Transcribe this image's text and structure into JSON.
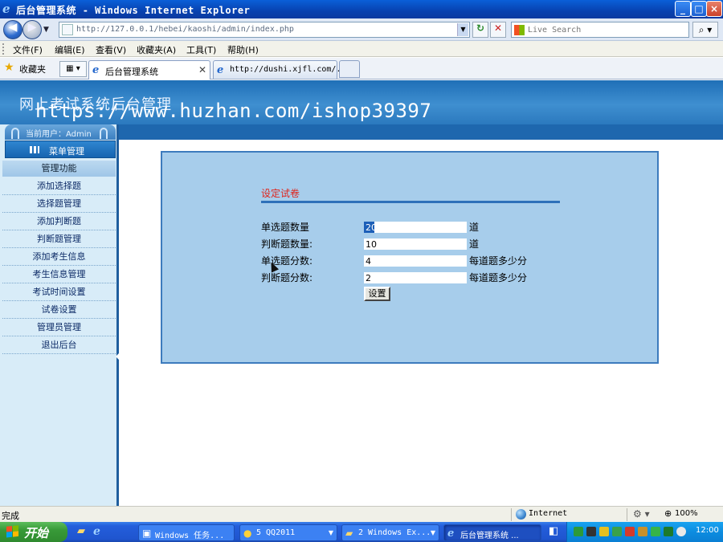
{
  "window": {
    "title": "后台管理系统 - Windows Internet Explorer",
    "controls": {
      "minimize": "_",
      "maximize": "□",
      "close": "×"
    }
  },
  "address_bar": {
    "url": "http://127.0.0.1/hebei/kaoshi/admin/index.php",
    "search_placeholder": "Live Search"
  },
  "menu": {
    "items": [
      "文件(F)",
      "编辑(E)",
      "查看(V)",
      "收藏夹(A)",
      "工具(T)",
      "帮助(H)"
    ]
  },
  "tabs": {
    "favorites_label": "收藏夹",
    "items": [
      {
        "label": "后台管理系统",
        "active": true
      },
      {
        "label": "http://dushi.xjfl.com/...",
        "active": false
      }
    ]
  },
  "site": {
    "title": "网上考试系统后台管理",
    "watermark": "https://www.huzhan.com/ishop39397"
  },
  "sidebar": {
    "user_label": "当前用户：Admin",
    "menu_header": "菜单管理",
    "section": "管理功能",
    "items": [
      {
        "label": "添加选择题"
      },
      {
        "label": "选择题管理"
      },
      {
        "label": "添加判断题"
      },
      {
        "label": "判断题管理"
      },
      {
        "label": "添加考生信息"
      },
      {
        "label": "考生信息管理"
      },
      {
        "label": "考试时间设置"
      },
      {
        "label": "试卷设置"
      },
      {
        "label": "管理员管理"
      },
      {
        "label": "退出后台"
      }
    ]
  },
  "form": {
    "title": "设定试卷",
    "fields": [
      {
        "label": "单选题数量",
        "value": "20",
        "suffix": "道"
      },
      {
        "label": "判断题数量:",
        "value": "10",
        "suffix": "道"
      },
      {
        "label": "单选题分数:",
        "value": "4",
        "suffix": "每道题多少分"
      },
      {
        "label": "判断题分数:",
        "value": "2",
        "suffix": "每道题多少分"
      }
    ],
    "submit_label": "设置"
  },
  "status_bar": {
    "status": "完成",
    "zone": "Internet",
    "zoom": "100%"
  },
  "taskbar": {
    "start_label": "开始",
    "tasks": [
      {
        "label": "Windows 任务...",
        "icon": "monitor-icon"
      },
      {
        "label": "5 QQ2011",
        "icon": "qq-penguin-icon"
      },
      {
        "label": "2 Windows Ex...",
        "icon": "folder-icon"
      },
      {
        "label": "后台管理系统 ...",
        "icon": "ie-icon"
      }
    ],
    "clock": "12:00"
  }
}
